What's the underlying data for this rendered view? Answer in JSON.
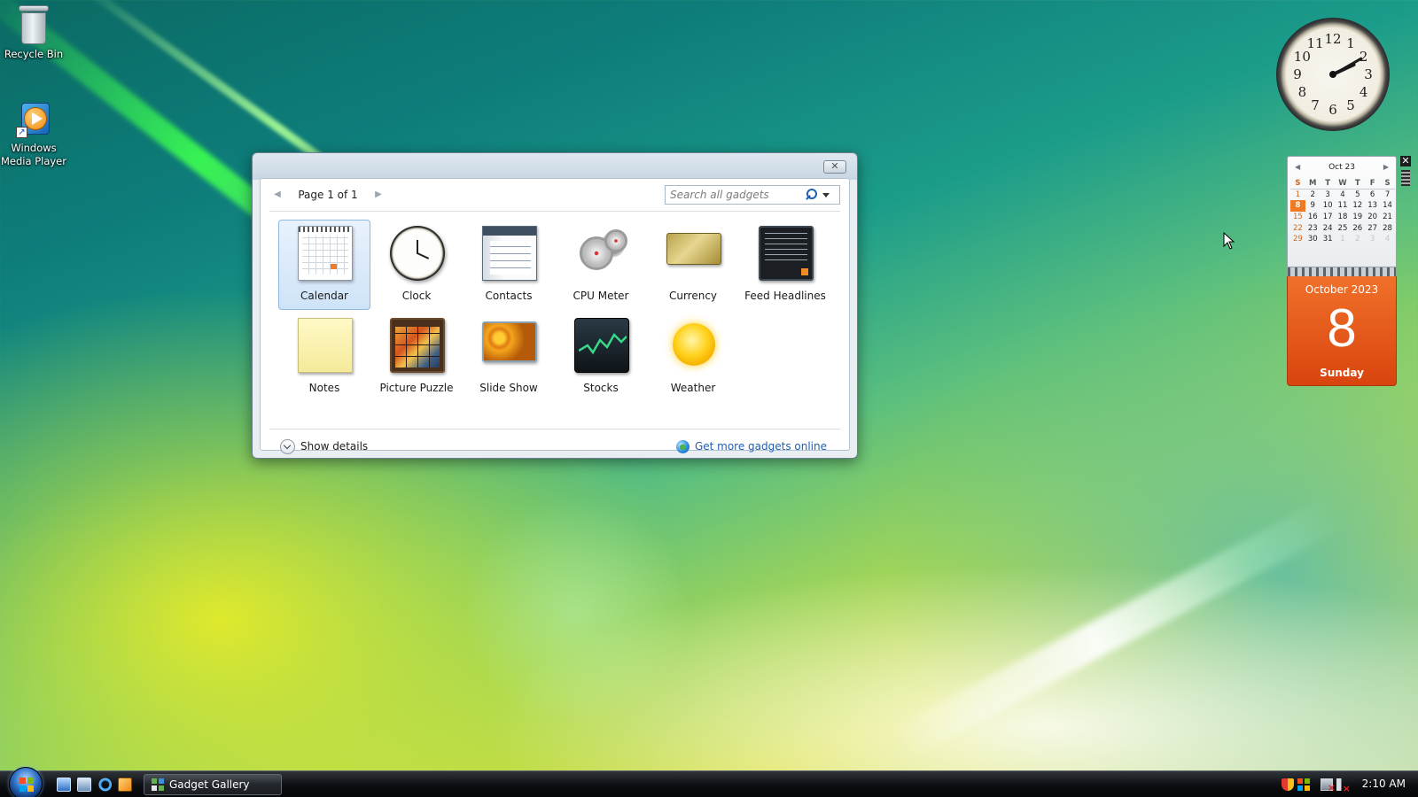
{
  "desktop": {
    "icons": [
      {
        "label": "Recycle Bin",
        "icon": "recycle-bin-icon"
      },
      {
        "label": "Windows Media Player",
        "icon": "windows-media-player-icon"
      }
    ]
  },
  "gallery": {
    "page_label": "Page 1 of 1",
    "search_placeholder": "Search all gadgets",
    "close_glyph": "✕",
    "gadgets": [
      {
        "label": "Calendar",
        "icon": "calendar-gadget-icon",
        "selected": true
      },
      {
        "label": "Clock",
        "icon": "clock-gadget-icon"
      },
      {
        "label": "Contacts",
        "icon": "contacts-gadget-icon"
      },
      {
        "label": "CPU Meter",
        "icon": "cpu-meter-gadget-icon"
      },
      {
        "label": "Currency",
        "icon": "currency-gadget-icon"
      },
      {
        "label": "Feed Headlines",
        "icon": "feed-headlines-gadget-icon"
      },
      {
        "label": "Notes",
        "icon": "notes-gadget-icon"
      },
      {
        "label": "Picture Puzzle",
        "icon": "picture-puzzle-gadget-icon"
      },
      {
        "label": "Slide Show",
        "icon": "slide-show-gadget-icon"
      },
      {
        "label": "Stocks",
        "icon": "stocks-gadget-icon"
      },
      {
        "label": "Weather",
        "icon": "weather-gadget-icon"
      }
    ],
    "show_details": "Show details",
    "get_more": "Get more gadgets online"
  },
  "clock_gadget": {
    "numerals": [
      "12",
      "1",
      "2",
      "3",
      "4",
      "5",
      "6",
      "7",
      "8",
      "9",
      "10",
      "11"
    ],
    "time": "2:10"
  },
  "calendar_gadget": {
    "month_header": "Oct 23",
    "weekdays": [
      "S",
      "M",
      "T",
      "W",
      "T",
      "F",
      "S"
    ],
    "weeks": [
      [
        "1",
        "2",
        "3",
        "4",
        "5",
        "6",
        "7"
      ],
      [
        "8",
        "9",
        "10",
        "11",
        "12",
        "13",
        "14"
      ],
      [
        "15",
        "16",
        "17",
        "18",
        "19",
        "20",
        "21"
      ],
      [
        "22",
        "23",
        "24",
        "25",
        "26",
        "27",
        "28"
      ],
      [
        "29",
        "30",
        "31",
        "1",
        "2",
        "3",
        "4"
      ]
    ],
    "today": "8",
    "month_year": "October 2023",
    "day_number": "8",
    "weekday_name": "Sunday",
    "close_glyph": "✕",
    "accent_color": "#f07a22"
  },
  "taskbar": {
    "task_label": "Gadget Gallery",
    "clock": "2:10 AM"
  }
}
